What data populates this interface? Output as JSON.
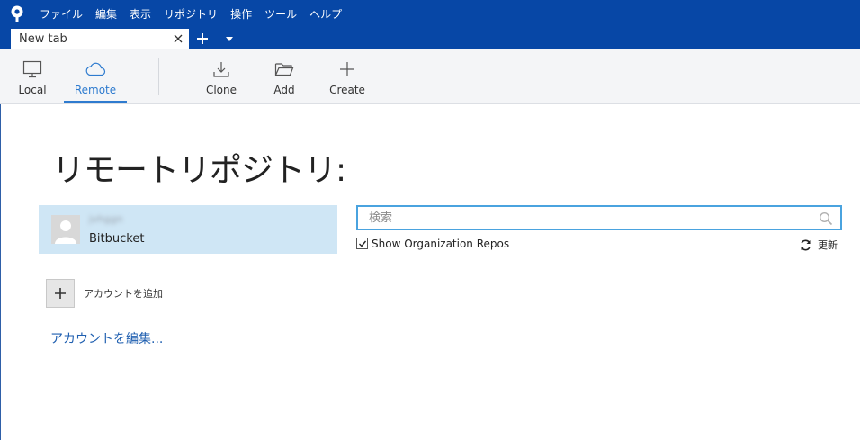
{
  "menu": {
    "items": [
      "ファイル",
      "編集",
      "表示",
      "リポジトリ",
      "操作",
      "ツール",
      "ヘルプ"
    ]
  },
  "tabs": {
    "current_label": "New tab"
  },
  "toolbar": {
    "local_label": "Local",
    "remote_label": "Remote",
    "clone_label": "Clone",
    "add_label": "Add",
    "create_label": "Create",
    "active": "remote"
  },
  "main": {
    "title": "リモートリポジトリ:",
    "account": {
      "name": "jvhggn",
      "host": "Bitbucket"
    },
    "add_account_label": "アカウントを追加",
    "edit_accounts_label": "アカウントを編集..."
  },
  "search": {
    "placeholder": "検索",
    "value": ""
  },
  "options": {
    "show_org_repos_label": "Show Organization Repos",
    "show_org_repos_checked": true,
    "refresh_label": "更新"
  },
  "colors": {
    "menubar": "#0747a6",
    "accent": "#2e7bcf",
    "selected_card": "#cfe6f5",
    "link": "#1f5fb0"
  }
}
